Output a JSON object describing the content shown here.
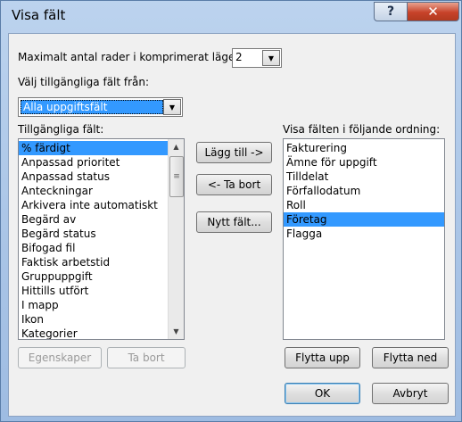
{
  "window": {
    "title": "Visa fält",
    "help_glyph": "?",
    "close_glyph": "✕"
  },
  "compressed": {
    "label": "Maximalt antal rader i komprimerat läge:",
    "value": "2"
  },
  "source": {
    "label": "Välj tillgängliga fält från:",
    "value": "Alla uppgiftsfält"
  },
  "available": {
    "label": "Tillgängliga fält:",
    "items": [
      "% färdigt",
      "Anpassad prioritet",
      "Anpassad status",
      "Anteckningar",
      "Arkivera inte automatiskt",
      "Begärd av",
      "Begärd status",
      "Bifogad fil",
      "Faktisk arbetstid",
      "Gruppuppgift",
      "Hittills utfört",
      "I mapp",
      "Ikon",
      "Kategorier"
    ],
    "selected_index": 0
  },
  "shown": {
    "label": "Visa fälten i följande ordning:",
    "items": [
      "Fakturering",
      "Ämne för uppgift",
      "Tilldelat",
      "Förfallodatum",
      "Roll",
      "Företag",
      "Flagga"
    ],
    "selected_index": 5
  },
  "buttons": {
    "add": "Lägg till ->",
    "remove": "<- Ta bort",
    "new_field": "Nytt fält...",
    "properties": "Egenskaper",
    "delete": "Ta bort",
    "move_up": "Flytta upp",
    "move_down": "Flytta ned",
    "ok": "OK",
    "cancel": "Avbryt"
  }
}
